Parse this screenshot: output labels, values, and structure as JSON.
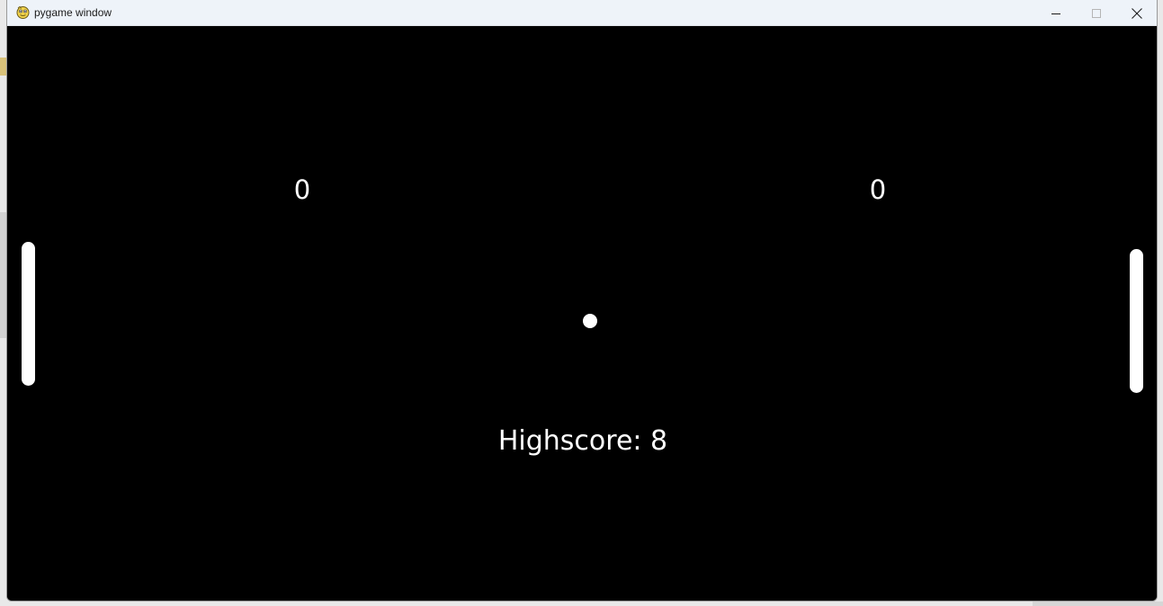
{
  "window": {
    "title": "pygame window",
    "icon": "pygame-snake-icon",
    "controls": {
      "minimize_icon": "minimize-icon",
      "maximize_icon": "maximize-icon",
      "close_icon": "close-icon"
    }
  },
  "game": {
    "background_color": "#000000",
    "foreground_color": "#ffffff",
    "score_left": "0",
    "score_right": "0",
    "highscore_text": "Highscore: 8"
  }
}
